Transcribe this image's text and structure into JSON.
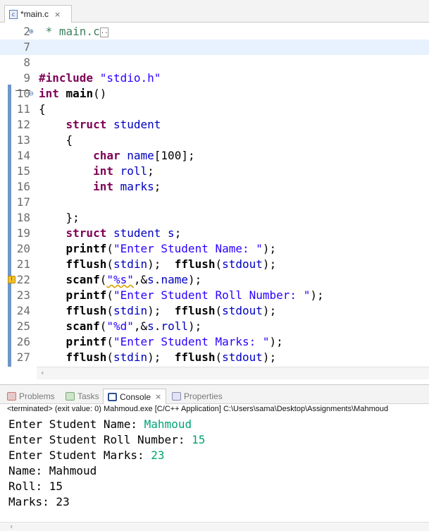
{
  "editor_tab": {
    "icon": "c-file-icon",
    "icon_glyph": "c",
    "label": "*main.c",
    "close": "×"
  },
  "editor": {
    "lines": [
      {
        "num": "2",
        "fold": "⊕",
        "text": "* main.c"
      },
      {
        "num": "7",
        "text": ""
      },
      {
        "num": "8",
        "text": ""
      },
      {
        "num": "9",
        "text": "#include \"stdio.h\""
      },
      {
        "num": "10",
        "fold": "⊖",
        "text": "int main()"
      },
      {
        "num": "11",
        "text": "{"
      },
      {
        "num": "12",
        "text": "    struct student"
      },
      {
        "num": "13",
        "text": "    {"
      },
      {
        "num": "14",
        "text": "        char name[100];"
      },
      {
        "num": "15",
        "text": "        int roll;"
      },
      {
        "num": "16",
        "text": "        int marks;"
      },
      {
        "num": "17",
        "text": ""
      },
      {
        "num": "18",
        "text": "    };"
      },
      {
        "num": "19",
        "text": "    struct student s;"
      },
      {
        "num": "20",
        "text": "    printf(\"Enter Student Name: \");"
      },
      {
        "num": "21",
        "text": "    fflush(stdin);  fflush(stdout);"
      },
      {
        "num": "22",
        "text": "    scanf(\"%s\",&s.name);",
        "warning": true
      },
      {
        "num": "23",
        "text": "    printf(\"Enter Student Roll Number: \");"
      },
      {
        "num": "24",
        "text": "    fflush(stdin);  fflush(stdout);"
      },
      {
        "num": "25",
        "text": "    scanf(\"%d\",&s.roll);"
      },
      {
        "num": "26",
        "text": "    printf(\"Enter Student Marks: \");"
      },
      {
        "num": "27",
        "text": "    fflush(stdin);  fflush(stdout);"
      }
    ],
    "current_line": "7",
    "hscroll_left": "‹"
  },
  "view_tabs": [
    {
      "label": "Problems",
      "icon": "problems-icon"
    },
    {
      "label": "Tasks",
      "icon": "tasks-icon"
    },
    {
      "label": "Console",
      "icon": "console-icon",
      "active": true,
      "close": "×"
    },
    {
      "label": "Properties",
      "icon": "properties-icon"
    }
  ],
  "console": {
    "terminated_text": "<terminated> (exit value: 0) Mahmoud.exe [C/C++ Application] C:\\Users\\sama\\Desktop\\Assignments\\Mahmoud",
    "lines": [
      {
        "prompt": "Enter Student Name: ",
        "input": "Mahmoud"
      },
      {
        "prompt": "Enter Student Roll Number: ",
        "input": "15"
      },
      {
        "prompt": "Enter Student Marks: ",
        "input": "23"
      },
      {
        "prompt": "Name: Mahmoud"
      },
      {
        "prompt": "Roll: 15"
      },
      {
        "prompt": "Marks: 23"
      }
    ],
    "hscroll_left": "‹"
  },
  "colors": {
    "keyword": "#7f0055",
    "string": "#2a00ff",
    "console_input": "#00a373",
    "current_line": "#e8f2fe",
    "ruler": "#6f95cc"
  }
}
